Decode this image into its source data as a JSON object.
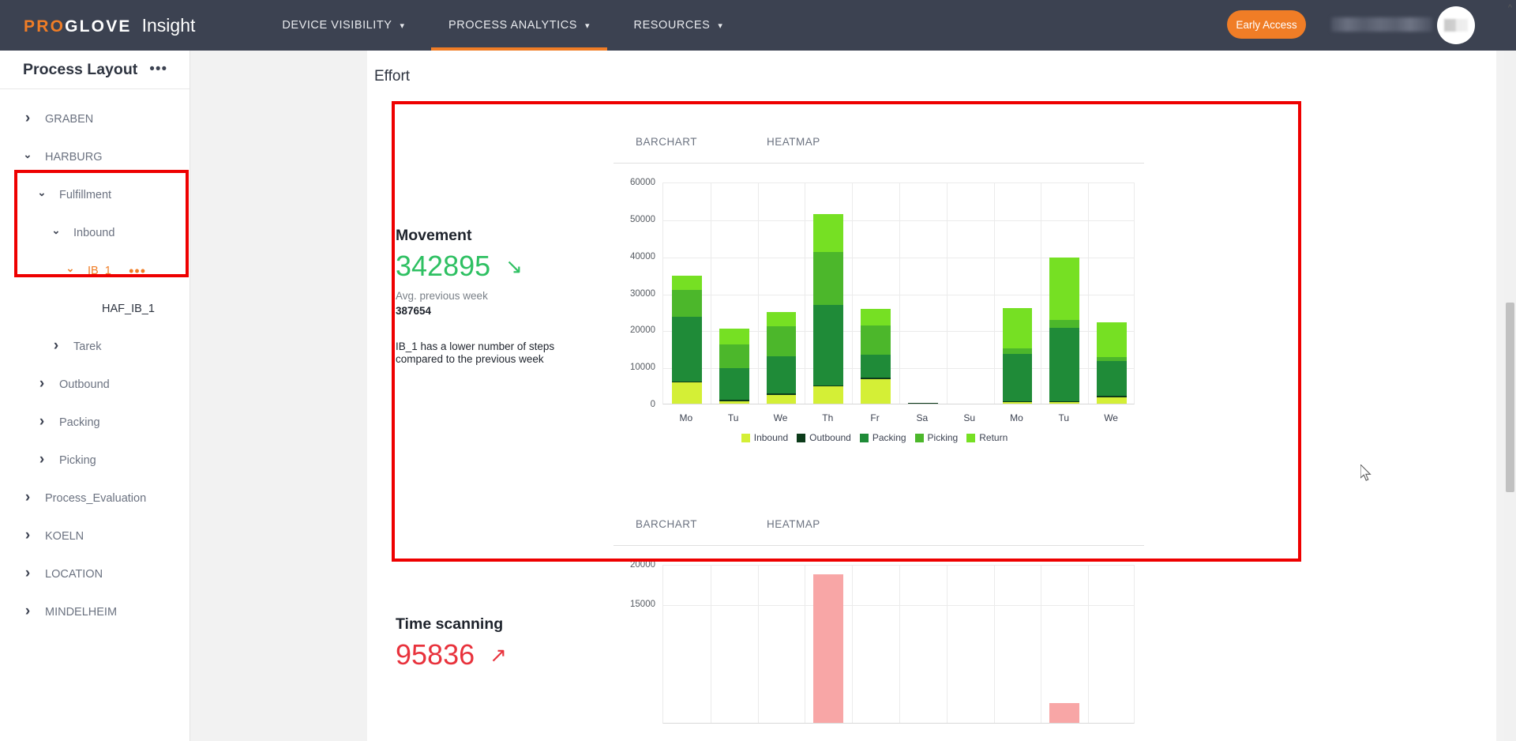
{
  "header": {
    "brand_pro": "PRO",
    "brand_glove": "GLOVE",
    "brand_product": "Insight",
    "nav": [
      {
        "label": "DEVICE VISIBILITY",
        "caret": "chevron-down-icon",
        "active": false
      },
      {
        "label": "PROCESS ANALYTICS",
        "caret": "chevron-down-icon",
        "active": true
      },
      {
        "label": "RESOURCES",
        "caret": "chevron-down-icon",
        "active": false
      }
    ],
    "early_access_label": "Early Access",
    "accent_color": "#f07d26",
    "bar_color": "#3c4251"
  },
  "sidebar": {
    "title": "Process Layout",
    "more_icon": "•••",
    "tree": [
      {
        "label": "GRABEN",
        "level": 0,
        "expanded": false,
        "selected": false,
        "leaf": false,
        "dots": false
      },
      {
        "label": "HARBURG",
        "level": 0,
        "expanded": true,
        "selected": false,
        "leaf": false,
        "dots": false
      },
      {
        "label": "Fulfillment",
        "level": 1,
        "expanded": true,
        "selected": false,
        "leaf": false,
        "dots": false
      },
      {
        "label": "Inbound",
        "level": 2,
        "expanded": true,
        "selected": false,
        "leaf": false,
        "dots": false
      },
      {
        "label": "IB_1",
        "level": 3,
        "expanded": true,
        "selected": true,
        "leaf": false,
        "dots": true
      },
      {
        "label": "HAF_IB_1",
        "level": 4,
        "expanded": false,
        "selected": false,
        "leaf": true,
        "dots": false
      },
      {
        "label": "Tarek",
        "level": 2,
        "expanded": false,
        "selected": false,
        "leaf": false,
        "dots": false
      },
      {
        "label": "Outbound",
        "level": 1,
        "expanded": false,
        "selected": false,
        "leaf": false,
        "dots": false
      },
      {
        "label": "Packing",
        "level": 1,
        "expanded": false,
        "selected": false,
        "leaf": false,
        "dots": false
      },
      {
        "label": "Picking",
        "level": 1,
        "expanded": false,
        "selected": false,
        "leaf": false,
        "dots": false
      },
      {
        "label": "Process_Evaluation",
        "level": 0,
        "expanded": false,
        "selected": false,
        "leaf": false,
        "dots": false
      },
      {
        "label": "KOELN",
        "level": 0,
        "expanded": false,
        "selected": false,
        "leaf": false,
        "dots": false
      },
      {
        "label": "LOCATION",
        "level": 0,
        "expanded": false,
        "selected": false,
        "leaf": false,
        "dots": false
      },
      {
        "label": "MINDELHEIM",
        "level": 0,
        "expanded": false,
        "selected": false,
        "leaf": false,
        "dots": false
      }
    ],
    "expanded_icon": "chevron-down-icon",
    "collapsed_icon": "chevron-right-icon"
  },
  "main": {
    "card_title": "Effort",
    "annotation_color": "#ee0000"
  },
  "panels": [
    {
      "id": "movement",
      "kpi_name": "Movement",
      "kpi_value": "342895",
      "kpi_value_color": "#2ec062",
      "trend_icon": "arrow-down-right-icon",
      "trend_direction": "down",
      "sub_label": "Avg. previous week",
      "sub_value": "387654",
      "note": "IB_1 has a lower number of steps compared to the previous week",
      "tabs": [
        {
          "label": "BARCHART",
          "active": true
        },
        {
          "label": "HEATMAP",
          "active": false
        }
      ],
      "highlighted": true
    },
    {
      "id": "time-scanning",
      "kpi_name": "Time scanning",
      "kpi_value": "95836",
      "kpi_value_color": "#e8323c",
      "trend_icon": "arrow-up-right-icon",
      "trend_direction": "up",
      "tabs": [
        {
          "label": "BARCHART",
          "active": true
        },
        {
          "label": "HEATMAP",
          "active": false
        }
      ],
      "highlighted": false
    }
  ],
  "chart_data": [
    {
      "id": "movement-barchart",
      "type": "bar",
      "stacked": true,
      "title": "",
      "xlabel": "",
      "ylabel": "",
      "ylim": [
        0,
        60000
      ],
      "yticks": [
        0,
        10000,
        20000,
        30000,
        40000,
        50000,
        60000
      ],
      "ytick_labels": [
        "0",
        "10000",
        "20000",
        "30000",
        "40000",
        "50000",
        "60000"
      ],
      "grid": true,
      "legend_position": "bottom",
      "categories": [
        "Mo",
        "Tu",
        "We",
        "Th",
        "Fr",
        "Sa",
        "Su",
        "Mo",
        "Tu",
        "We"
      ],
      "series": [
        {
          "name": "Inbound",
          "color": "#d4ef36",
          "values": [
            5700,
            700,
            2400,
            4700,
            6700,
            0,
            0,
            500,
            400,
            1800
          ]
        },
        {
          "name": "Outbound",
          "color": "#0c3b1a",
          "values": [
            200,
            300,
            400,
            200,
            300,
            250,
            0,
            200,
            200,
            300
          ]
        },
        {
          "name": "Packing",
          "color": "#1f8b38",
          "values": [
            17600,
            8600,
            10000,
            21700,
            6300,
            0,
            0,
            12700,
            19900,
            9400
          ]
        },
        {
          "name": "Picking",
          "color": "#4cb72b",
          "values": [
            7200,
            6400,
            8200,
            14500,
            7900,
            0,
            0,
            1600,
            2200,
            1200
          ]
        },
        {
          "name": "Return",
          "color": "#76e023",
          "values": [
            3800,
            4300,
            3700,
            10100,
            4500,
            0,
            0,
            10900,
            16900,
            9300
          ]
        }
      ],
      "totals": [
        34500,
        20300,
        24700,
        51200,
        25700,
        250,
        0,
        25900,
        39600,
        22400
      ]
    },
    {
      "id": "time-scanning-barchart",
      "type": "bar",
      "stacked": false,
      "title": "",
      "xlabel": "",
      "ylabel": "",
      "ylim": [
        0,
        20000
      ],
      "yticks": [
        15000,
        20000
      ],
      "ytick_labels": [
        "15000",
        "20000"
      ],
      "grid": true,
      "legend_position": "bottom",
      "categories": [
        "Mo",
        "Tu",
        "We",
        "Th",
        "Fr",
        "Sa",
        "Su",
        "Mo",
        "Tu",
        "We"
      ],
      "series": [
        {
          "name": "Time scanning",
          "color": "#f8a6a6",
          "values": [
            0,
            0,
            0,
            18700,
            0,
            0,
            0,
            0,
            2500,
            0
          ]
        }
      ]
    }
  ],
  "scroll": {
    "up_arrow_icon": "chevron-up-icon",
    "thumb_visible": true
  },
  "cursor": {
    "icon": "mouse-pointer-icon"
  }
}
